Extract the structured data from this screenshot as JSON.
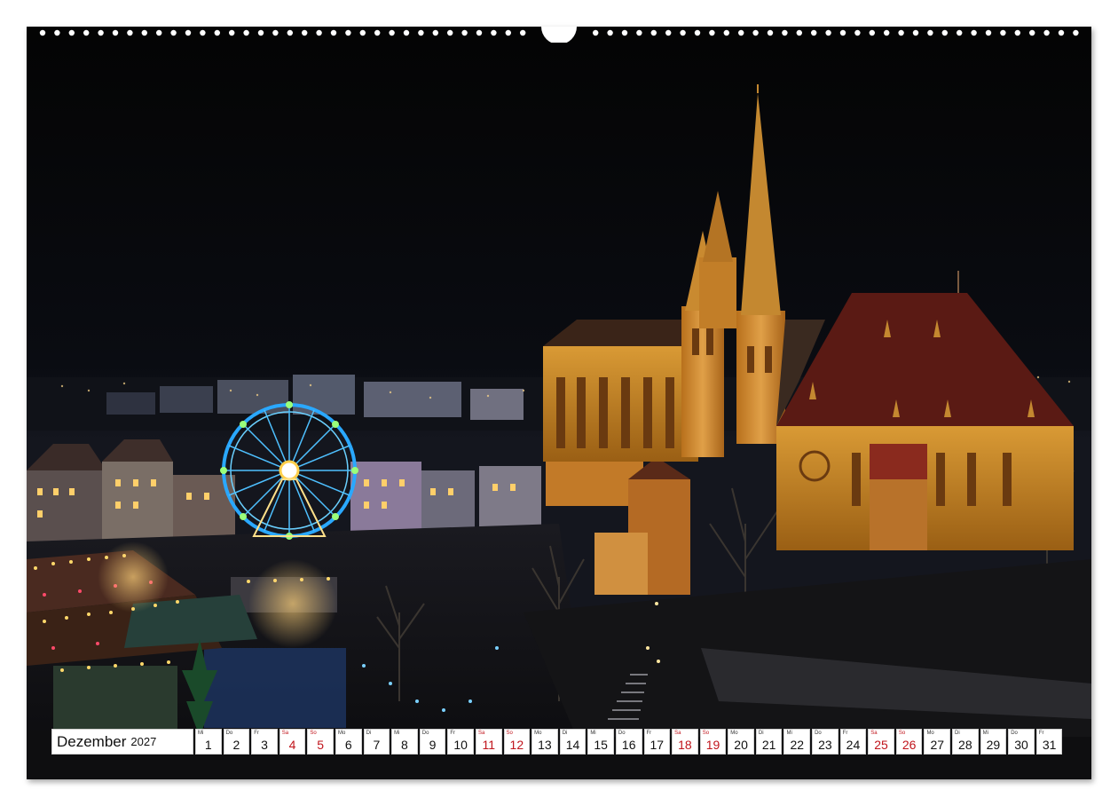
{
  "calendar": {
    "month": "Dezember",
    "year": "2027",
    "weekend_color": "#c0141b",
    "days": [
      {
        "num": "1",
        "dow": "Mi",
        "weekend": false
      },
      {
        "num": "2",
        "dow": "Do",
        "weekend": false
      },
      {
        "num": "3",
        "dow": "Fr",
        "weekend": false
      },
      {
        "num": "4",
        "dow": "Sa",
        "weekend": true
      },
      {
        "num": "5",
        "dow": "So",
        "weekend": true
      },
      {
        "num": "6",
        "dow": "Mo",
        "weekend": false
      },
      {
        "num": "7",
        "dow": "Di",
        "weekend": false
      },
      {
        "num": "8",
        "dow": "Mi",
        "weekend": false
      },
      {
        "num": "9",
        "dow": "Do",
        "weekend": false
      },
      {
        "num": "10",
        "dow": "Fr",
        "weekend": false
      },
      {
        "num": "11",
        "dow": "Sa",
        "weekend": true
      },
      {
        "num": "12",
        "dow": "So",
        "weekend": true
      },
      {
        "num": "13",
        "dow": "Mo",
        "weekend": false
      },
      {
        "num": "14",
        "dow": "Di",
        "weekend": false
      },
      {
        "num": "15",
        "dow": "Mi",
        "weekend": false
      },
      {
        "num": "16",
        "dow": "Do",
        "weekend": false
      },
      {
        "num": "17",
        "dow": "Fr",
        "weekend": false
      },
      {
        "num": "18",
        "dow": "Sa",
        "weekend": true
      },
      {
        "num": "19",
        "dow": "So",
        "weekend": true
      },
      {
        "num": "20",
        "dow": "Mo",
        "weekend": false
      },
      {
        "num": "21",
        "dow": "Di",
        "weekend": false
      },
      {
        "num": "22",
        "dow": "Mi",
        "weekend": false
      },
      {
        "num": "23",
        "dow": "Do",
        "weekend": false
      },
      {
        "num": "24",
        "dow": "Fr",
        "weekend": false
      },
      {
        "num": "25",
        "dow": "Sa",
        "weekend": true
      },
      {
        "num": "26",
        "dow": "So",
        "weekend": true
      },
      {
        "num": "27",
        "dow": "Mo",
        "weekend": false
      },
      {
        "num": "28",
        "dow": "Di",
        "weekend": false
      },
      {
        "num": "29",
        "dow": "Mi",
        "weekend": false
      },
      {
        "num": "30",
        "dow": "Do",
        "weekend": false
      },
      {
        "num": "31",
        "dow": "Fr",
        "weekend": false
      }
    ]
  },
  "photo": {
    "sky_color": "#050505",
    "cathedral_color": "#c8861e",
    "roof_color": "#5a1a14",
    "ferris_wheel_color": "#2aa8ff"
  }
}
